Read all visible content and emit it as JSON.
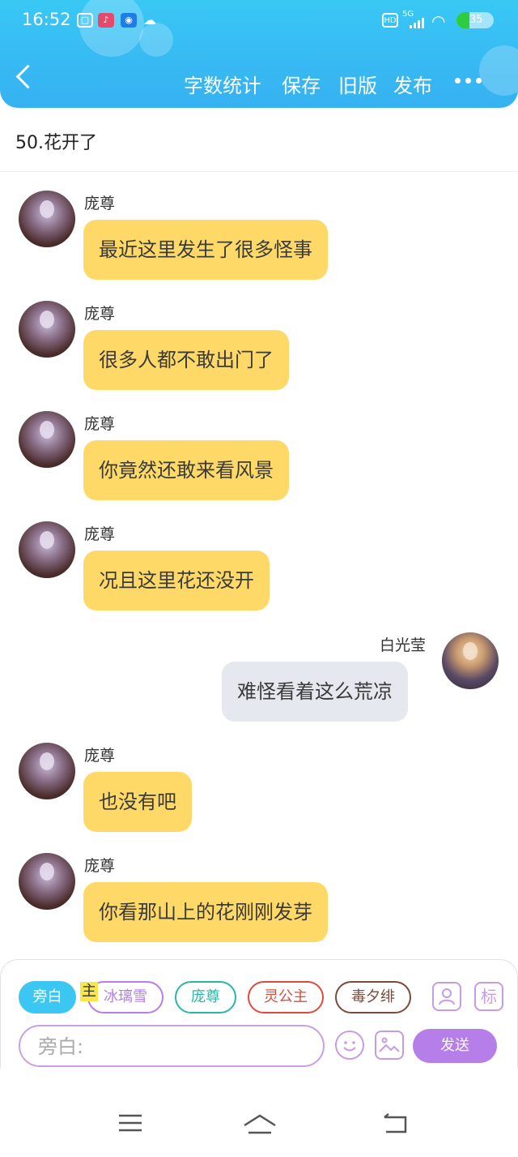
{
  "status_bar": {
    "time": "16:52",
    "net": "5G",
    "hd": "HD",
    "battery_text": "35",
    "battery_color": "#2ecc40"
  },
  "header": {
    "back_icon": "chevron-left-icon",
    "actions": [
      "字数统计",
      "保存",
      "旧版",
      "发布"
    ],
    "more_icon": "more-horizontal-icon"
  },
  "chapter_title": "50.花开了",
  "messages": [
    {
      "speaker": "庞尊",
      "side": "left",
      "text": "最近这里发生了很多怪事"
    },
    {
      "speaker": "庞尊",
      "side": "left",
      "text": "很多人都不敢出门了"
    },
    {
      "speaker": "庞尊",
      "side": "left",
      "text": "你竟然还敢来看风景"
    },
    {
      "speaker": "庞尊",
      "side": "left",
      "text": "况且这里花还没开"
    },
    {
      "speaker": "白光莹",
      "side": "right",
      "text": "难怪看着这么荒凉"
    },
    {
      "speaker": "庞尊",
      "side": "left",
      "text": "也没有吧"
    },
    {
      "speaker": "庞尊",
      "side": "left",
      "text": "你看那山上的花刚刚发芽"
    }
  ],
  "characters": [
    {
      "label": "旁白",
      "color": "#3cc6f2",
      "active": true
    },
    {
      "label": "冰璃雪",
      "color": "#b57ee8",
      "active": false
    },
    {
      "label": "庞尊",
      "color": "#2ab6a5",
      "active": false
    },
    {
      "label": "灵公主",
      "color": "#e04a3c",
      "active": false
    },
    {
      "label": "毒夕绯",
      "color": "#7a4a3a",
      "active": false
    }
  ],
  "main_badge": "主",
  "tool_icons": {
    "character": "user-card-icon",
    "mark": "标"
  },
  "input": {
    "placeholder": "旁白:",
    "value": ""
  },
  "send_label": "发送",
  "colors": {
    "header": "#37b9f3",
    "bubble_left": "#ffd968",
    "bubble_right": "#e5e8ef",
    "accent_purple": "#b57ee8"
  },
  "nav_icons": [
    "menu-icon",
    "home-icon",
    "back-icon"
  ]
}
